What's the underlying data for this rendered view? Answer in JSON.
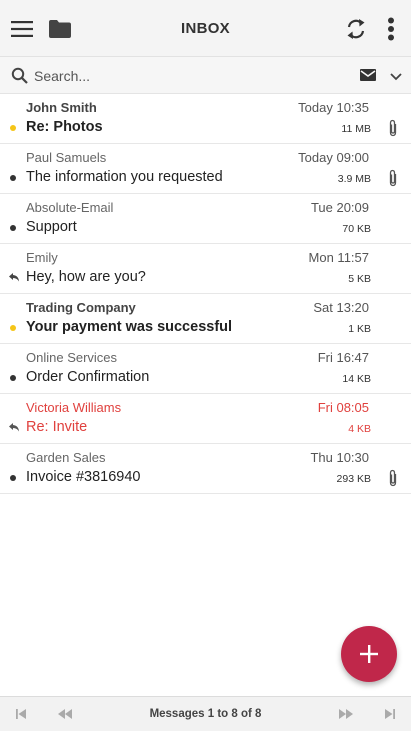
{
  "header": {
    "title": "INBOX"
  },
  "search": {
    "placeholder": "Search..."
  },
  "messages": [
    {
      "from": "John Smith",
      "subject": "Re: Photos",
      "date": "Today 10:35",
      "size": "11 MB",
      "attachment": true,
      "status": "unread",
      "style": "unread"
    },
    {
      "from": "Paul Samuels",
      "subject": "The information you requested",
      "date": "Today 09:00",
      "size": "3.9 MB",
      "attachment": true,
      "status": "read",
      "style": "normal"
    },
    {
      "from": "Absolute-Email",
      "subject": "Support",
      "date": "Tue 20:09",
      "size": "70 KB",
      "attachment": false,
      "status": "read",
      "style": "normal"
    },
    {
      "from": "Emily",
      "subject": "Hey, how are you?",
      "date": "Mon 11:57",
      "size": "5 KB",
      "attachment": false,
      "status": "replied",
      "style": "normal"
    },
    {
      "from": "Trading Company",
      "subject": "Your payment was successful",
      "date": "Sat 13:20",
      "size": "1 KB",
      "attachment": false,
      "status": "unread",
      "style": "unread"
    },
    {
      "from": "Online Services",
      "subject": "Order Confirmation",
      "date": "Fri 16:47",
      "size": "14 KB",
      "attachment": false,
      "status": "read",
      "style": "normal"
    },
    {
      "from": "Victoria Williams",
      "subject": "Re: Invite",
      "date": "Fri 08:05",
      "size": "4 KB",
      "attachment": false,
      "status": "replied",
      "style": "flagged"
    },
    {
      "from": "Garden Sales",
      "subject": "Invoice #3816940",
      "date": "Thu 10:30",
      "size": "293 KB",
      "attachment": true,
      "status": "read",
      "style": "normal"
    }
  ],
  "pager": {
    "info": "Messages 1 to 8 of 8"
  },
  "colors": {
    "accent": "#c0274a",
    "unread_dot": "#f5c518",
    "flagged": "#e0413e"
  },
  "icons": {
    "menu": "hamburger-icon",
    "folder": "folder-icon",
    "refresh": "refresh-icon",
    "more": "more-vertical-icon",
    "search": "search-icon",
    "mail": "mail-icon",
    "caret": "chevron-down-icon",
    "attachment": "paperclip-icon",
    "reply": "reply-icon",
    "compose": "plus-icon",
    "first": "first-page-icon",
    "prev": "rewind-icon",
    "next": "fast-forward-icon",
    "last": "last-page-icon"
  }
}
